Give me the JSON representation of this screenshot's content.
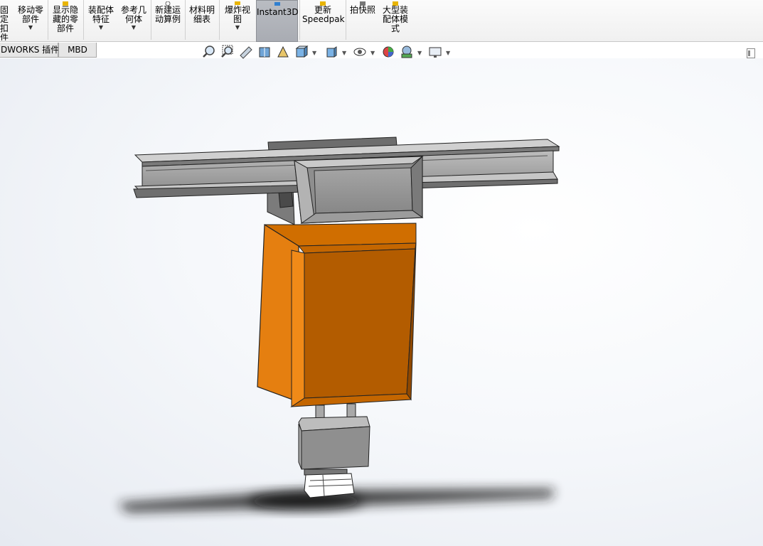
{
  "ribbon": {
    "buttons": [
      {
        "label": "固定\n扣\n件",
        "dropdown": false
      },
      {
        "label": "移动零\n部件",
        "dropdown": true
      },
      {
        "label": "显示隐\n藏的零\n部件",
        "dropdown": false
      },
      {
        "label": "装配体\n特征",
        "dropdown": true
      },
      {
        "label": "参考几\n何体",
        "dropdown": true
      },
      {
        "label": "新建运\n动算例",
        "dropdown": false
      },
      {
        "label": "材料明\n细表",
        "dropdown": false
      },
      {
        "label": "爆炸视\n图",
        "dropdown": true
      },
      {
        "label": "Instant3D",
        "dropdown": false,
        "active": true
      },
      {
        "label": "更新\nSpeedpak",
        "dropdown": false
      },
      {
        "label": "拍快照",
        "dropdown": false
      },
      {
        "label": "大型装\n配体模\n式",
        "dropdown": false
      }
    ]
  },
  "tabs": [
    {
      "label": "DWORKS 插件"
    },
    {
      "label": "MBD"
    }
  ],
  "hud": {
    "icons": [
      "zoom-to-fit-icon",
      "zoom-to-area-icon",
      "previous-view-icon",
      "section-view-icon",
      "dynamic-annotation-icon",
      "view-orientation-icon",
      "display-style-icon",
      "hide-show-items-icon",
      "edit-appearance-icon",
      "apply-scene-icon",
      "view-settings-icon"
    ]
  },
  "colors": {
    "cabinet_front": "#b35c00",
    "cabinet_side": "#e57f10",
    "steel_gray": "#8f8f8f",
    "beam_gray": "#9a9a9a",
    "viewport_bg": "#eef1f6",
    "ribbon_bg": "#f5f5f5"
  }
}
